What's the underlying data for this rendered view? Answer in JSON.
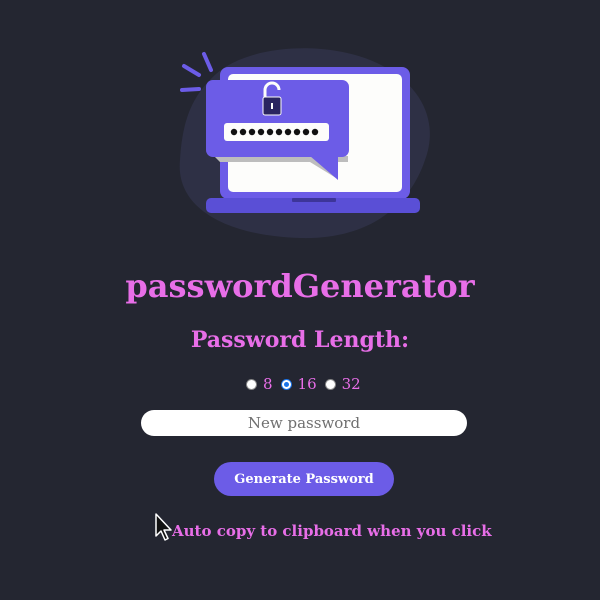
{
  "app": {
    "title": "passwordGenerator"
  },
  "length_section": {
    "heading": "Password Length:",
    "options": [
      {
        "label": "8",
        "checked": false
      },
      {
        "label": "16",
        "checked": true
      },
      {
        "label": "32",
        "checked": false
      }
    ]
  },
  "password_field": {
    "placeholder": "New password",
    "value": ""
  },
  "generate_button": {
    "label": "Generate Password"
  },
  "copy_note": {
    "text": "Auto copy to clipboard when you click"
  },
  "colors": {
    "background": "#242631",
    "accent_text": "#e86ee8",
    "button": "#6c5ce7",
    "illustration_purple": "#6c5ce7",
    "illustration_blob": "#2e3045"
  },
  "icons": {
    "hero": "laptop-password-illustration",
    "lock": "unlocked-padlock-icon",
    "cursor": "mouse-pointer-icon"
  }
}
